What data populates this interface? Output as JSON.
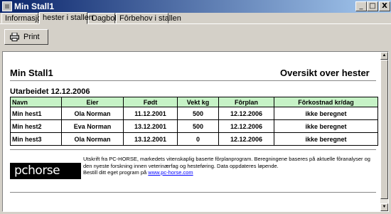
{
  "window": {
    "title": "Min Stall1",
    "controls": {
      "minimize": "_",
      "maximize": "□",
      "close": "X"
    }
  },
  "tabs": [
    {
      "label": "Informasjon",
      "active": false
    },
    {
      "label": "hester i stallen",
      "active": true
    },
    {
      "label": "Dagbok",
      "active": false
    },
    {
      "label": "Fôrbehov i stallen",
      "active": false
    }
  ],
  "toolbar": {
    "print_label": "Print",
    "print_icon": "printer-icon"
  },
  "report": {
    "title_left": "Min Stall1",
    "title_right": "Oversikt over hester",
    "date_line": "Utarbeidet 12.12.2006",
    "table": {
      "headers": [
        "Navn",
        "Eier",
        "Født",
        "Vekt kg",
        "Fôrplan",
        "Fôrkostnad kr/dag"
      ],
      "rows": [
        [
          "Min hest1",
          "Ola Norman",
          "11.12.2001",
          "500",
          "12.12.2006",
          "ikke beregnet"
        ],
        [
          "Min hest2",
          "Eva Norman",
          "13.12.2001",
          "500",
          "12.12.2006",
          "ikke beregnet"
        ],
        [
          "Min hest3",
          "Ola Norman",
          "13.12.2001",
          "0",
          "12.12.2006",
          "ikke beregnet"
        ]
      ],
      "header_color": "#c6f2c6"
    },
    "footer": {
      "logo_text": "pchorse",
      "line1": "Utskrift fra PC-HORSE, markedets vitenskaplig baserte fôrplanprogram. Beregningene baseres på aktuelle fôranalyser og den nyeste forskning innen veterinærfag og hesteføring. Data oppdateres løpende.",
      "line2_prefix": "Bestill ditt eget program på ",
      "link": "www.pc-horse.com"
    }
  }
}
